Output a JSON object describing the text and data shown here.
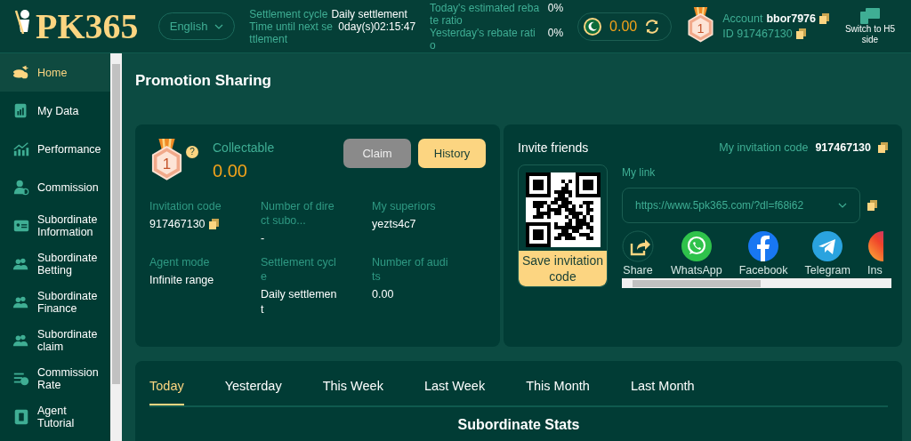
{
  "header": {
    "logo": "PK365",
    "language": "English",
    "settlement_label": "Settlement cycle",
    "settlement_value": "Daily settlement",
    "next_label": "Time until next settlement",
    "next_value": "0day(s)02:15:47",
    "rebate_today_label": "Today's estimated rebate ratio",
    "rebate_today_value": "0%",
    "rebate_yesterday_label": "Yesterday's rebate ratio",
    "rebate_yesterday_value": "0%",
    "balance": "0.00",
    "rank": "1",
    "account_label": "Account",
    "account_value": "bbor7976",
    "id_text": "ID 917467130",
    "switch_label": "Switch to H5 side"
  },
  "sidebar": {
    "items": [
      {
        "label": "Home",
        "selected": true
      },
      {
        "label": "My Data",
        "selected": false
      },
      {
        "label": "Performance",
        "selected": false
      },
      {
        "label": "Commission",
        "selected": false
      },
      {
        "label": "Subordinate Information",
        "selected": false
      },
      {
        "label": "Subordinate Betting",
        "selected": false
      },
      {
        "label": "Subordinate Finance",
        "selected": false
      },
      {
        "label": "Subordinate claim",
        "selected": false
      },
      {
        "label": "Commission Rate",
        "selected": false
      },
      {
        "label": "Agent Tutorial",
        "selected": false
      }
    ]
  },
  "page_title": "Promotion Sharing",
  "summary": {
    "rank": "1",
    "help": "?",
    "collectable_label": "Collectable",
    "collectable_value": "0.00",
    "buttons": [
      {
        "label": "Claim",
        "disabled": true
      },
      {
        "label": "History",
        "disabled": false
      }
    ],
    "fields": [
      {
        "label": "Invitation code",
        "value": "917467130",
        "copy": true
      },
      {
        "label": "Number of direct subo...",
        "value": "-",
        "copy": false
      },
      {
        "label": "My superiors",
        "value": "yezts4c7",
        "copy": false
      },
      {
        "label": "Agent mode",
        "value": "Infinite range",
        "copy": false
      },
      {
        "label": "Settlement cycle",
        "value": "Daily settlement",
        "copy": false
      },
      {
        "label": "Number of audits",
        "value": "0.00",
        "copy": false
      }
    ]
  },
  "invite": {
    "title": "Invite friends",
    "code_label": "My invitation code",
    "code_value": "917467130",
    "save_button": "Save invitation code",
    "link_label": "My link",
    "link_value": "https://www.5pk365.com/?dl=f68i62",
    "share": [
      {
        "kind": "share",
        "label": "Share"
      },
      {
        "kind": "whatsapp",
        "label": "WhatsApp"
      },
      {
        "kind": "facebook",
        "label": "Facebook"
      },
      {
        "kind": "telegram",
        "label": "Telegram"
      },
      {
        "kind": "instagram",
        "label": "Ins"
      }
    ]
  },
  "period_tabs": [
    {
      "label": "Today",
      "selected": true
    },
    {
      "label": "Yesterday",
      "selected": false
    },
    {
      "label": "This Week",
      "selected": false
    },
    {
      "label": "Last Week",
      "selected": false
    },
    {
      "label": "This Month",
      "selected": false
    },
    {
      "label": "Last Month",
      "selected": false
    }
  ],
  "stats_title": "Subordinate Stats"
}
